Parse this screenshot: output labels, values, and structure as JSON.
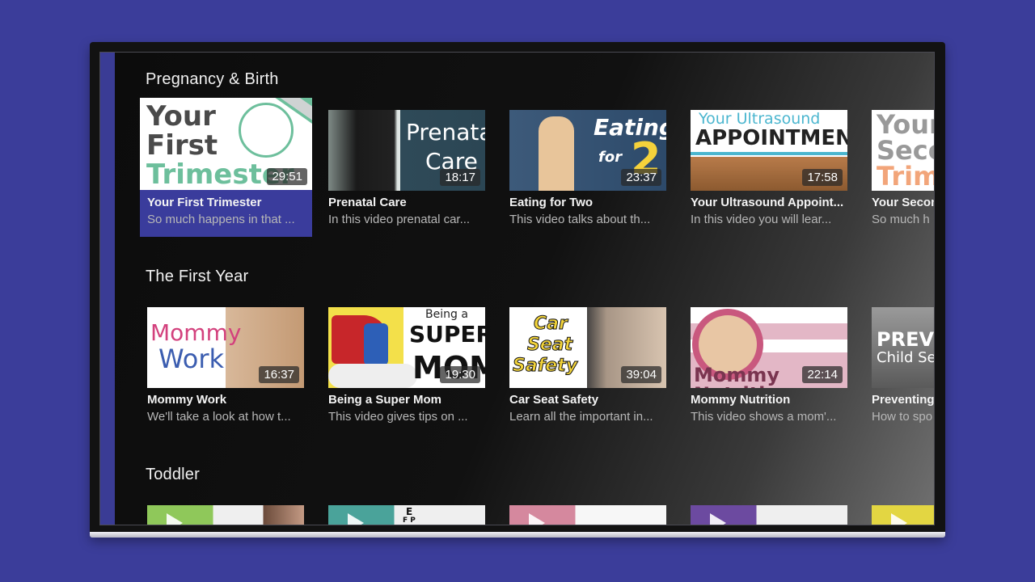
{
  "rows": [
    {
      "title": "Pregnancy & Birth",
      "tiles": [
        {
          "title": "Your First Trimester",
          "desc": "So much happens in that ...",
          "duration": "29:51",
          "art": [
            "Your",
            "First",
            "Trimester"
          ],
          "focused": true
        },
        {
          "title": "Prenatal Care",
          "desc": "In this video prenatal car...",
          "duration": "18:17",
          "art": [
            "Prenatal",
            "Care"
          ]
        },
        {
          "title": "Eating for Two",
          "desc": "This video talks about th...",
          "duration": "23:37",
          "art": [
            "Eating",
            "for",
            "2"
          ]
        },
        {
          "title": "Your Ultrasound Appoint...",
          "desc": "In this video you will lear...",
          "duration": "17:58",
          "art": [
            "Your Ultrasound",
            "APPOINTMENT"
          ]
        },
        {
          "title": "Your Secon",
          "desc": "So much h",
          "art": [
            "Your",
            "Seco",
            "Trim"
          ]
        }
      ]
    },
    {
      "title": "The First Year",
      "tiles": [
        {
          "title": "Mommy Work",
          "desc": "We'll take a look at how t...",
          "duration": "16:37",
          "art": [
            "Mommy",
            "Work"
          ]
        },
        {
          "title": "Being a Super Mom",
          "desc": "This video gives tips on ...",
          "duration": "19:30",
          "art": [
            "Being a",
            "SUPER",
            "MOM"
          ]
        },
        {
          "title": "Car Seat Safety",
          "desc": "Learn all the important in...",
          "duration": "39:04",
          "art": [
            "Car",
            "Seat",
            "Safety"
          ]
        },
        {
          "title": "Mommy Nutrition",
          "desc": "This video shows a mom'...",
          "duration": "22:14",
          "art": [
            "Mommy Nutrition"
          ]
        },
        {
          "title": "Preventing",
          "desc": "How to spo",
          "art": [
            "PREVENT",
            "Child Sexua"
          ]
        }
      ]
    },
    {
      "title": "Toddler",
      "tiles": [
        {
          "art": []
        },
        {
          "art": [
            "E",
            "F P"
          ]
        },
        {
          "art": []
        },
        {
          "art": []
        },
        {
          "art": []
        }
      ]
    }
  ],
  "colors": {
    "background": "#3b3d9a",
    "focus": "#3a3c9c",
    "side_rail": "#3a3c95"
  }
}
